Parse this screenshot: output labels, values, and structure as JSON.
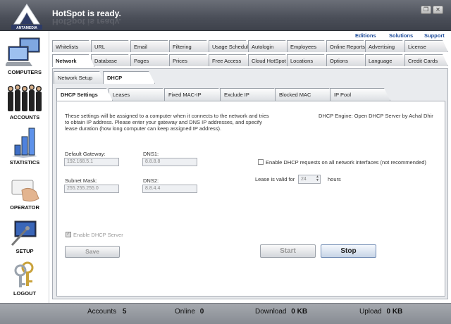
{
  "app": {
    "title": "HotSpot is ready."
  },
  "window": {
    "restore_glyph": "❐",
    "close_glyph": "✕"
  },
  "sidebar": {
    "items": [
      {
        "label": "COMPUTERS",
        "icon": "computers-icon"
      },
      {
        "label": "ACCOUNTS",
        "icon": "accounts-icon"
      },
      {
        "label": "STATISTICS",
        "icon": "statistics-icon"
      },
      {
        "label": "OPERATOR",
        "icon": "operator-icon"
      },
      {
        "label": "SETUP",
        "icon": "setup-icon"
      },
      {
        "label": "LOGOUT",
        "icon": "logout-icon"
      }
    ]
  },
  "toplinks": [
    "Editions",
    "Solutions",
    "Support"
  ],
  "tabs_row1": [
    "Whitelists",
    "URL",
    "Email",
    "Filtering",
    "Usage Schedule",
    "Autologin",
    "Employees",
    "Online Reports",
    "Advertising",
    "License"
  ],
  "tabs_row2": [
    "Network",
    "Database",
    "Pages",
    "Prices",
    "Free Access",
    "Cloud HotSpot",
    "Locations",
    "Options",
    "Language",
    "Credit Cards"
  ],
  "network_tabs": [
    "Network Setup",
    "DHCP"
  ],
  "dhcp_tabs": [
    "DHCP Settings",
    "Leases",
    "Fixed MAC-IP",
    "Exclude IP",
    "Blocked MAC",
    "IP Pool"
  ],
  "dhcp": {
    "description": "These settings will be assigned to a computer when it connects to the network and tries to obtain IP address. Please enter your gateway and DNS IP addresses, and specify lease duration (how long computer can keep assigned IP address).",
    "engine": "DHCP Engine: Open DHCP Server by Achal Dhir",
    "gateway_label": "Default Gateway:",
    "gateway_value": "192.168.5.1",
    "dns1_label": "DNS1:",
    "dns1_value": "8.8.8.8",
    "subnet_label": "Subnet Mask:",
    "subnet_value": "255.255.255.0",
    "dns2_label": "DNS2:",
    "dns2_value": "8.8.4.4",
    "all_interfaces_label": "Enable DHCP requests on all network interfaces (not recommended)",
    "lease_label": "Lease is valid for",
    "lease_value": "24",
    "lease_unit": "hours",
    "enable_label": "Enable DHCP Server",
    "save_label": "Save",
    "start_label": "Start",
    "stop_label": "Stop"
  },
  "status": {
    "accounts_label": "Accounts",
    "accounts_value": "5",
    "online_label": "Online",
    "online_value": "0",
    "download_label": "Download",
    "download_value": "0 KB",
    "upload_label": "Upload",
    "upload_value": "0 KB"
  }
}
